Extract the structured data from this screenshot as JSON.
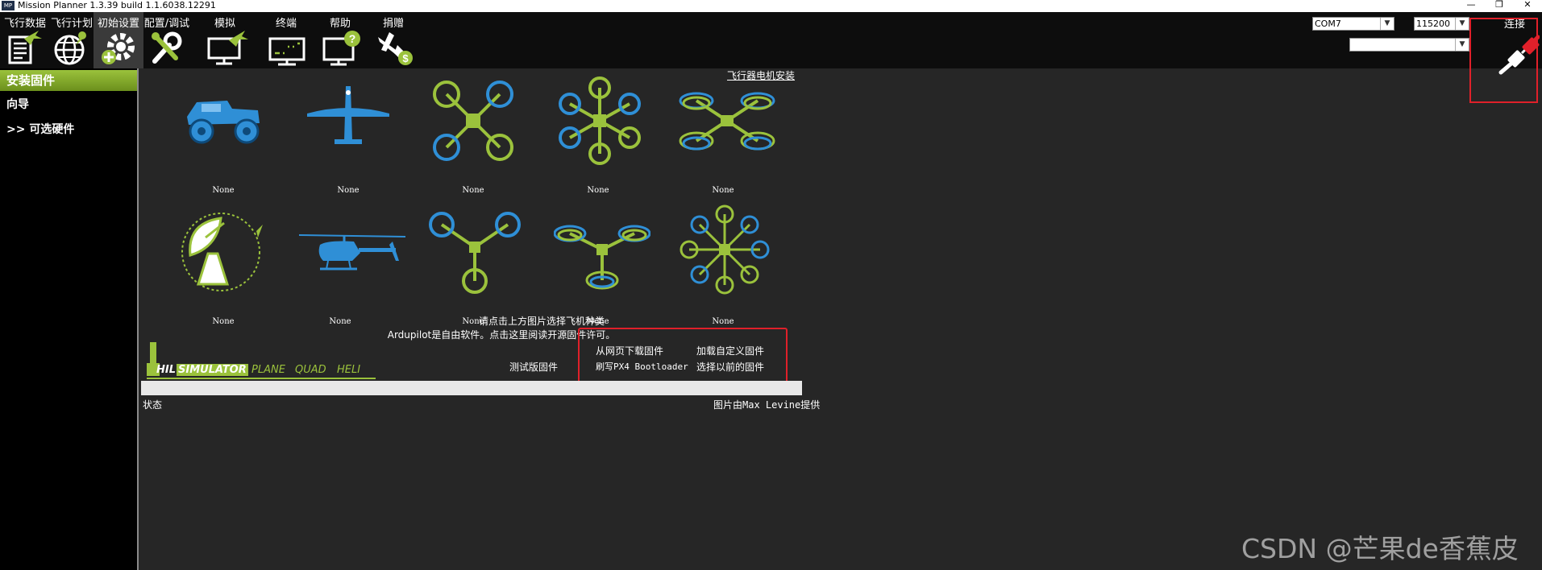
{
  "window": {
    "title": "Mission Planner 1.3.39 build 1.1.6038.12291",
    "logo_text": "MP"
  },
  "toolbar": {
    "menus": [
      {
        "label": "飞行数据",
        "icon": "flight-data-icon"
      },
      {
        "label": "飞行计划",
        "icon": "flight-plan-icon"
      },
      {
        "label": "初始设置",
        "icon": "initial-setup-icon"
      },
      {
        "label": "配置/调试",
        "icon": "config-tuning-icon"
      },
      {
        "label": "模拟",
        "icon": "simulation-icon"
      },
      {
        "label": "终端",
        "icon": "terminal-icon"
      },
      {
        "label": "帮助",
        "icon": "help-icon"
      },
      {
        "label": "捐赠",
        "icon": "donate-icon"
      }
    ],
    "active_menu": "初始设置",
    "port": "COM7",
    "baud": "115200",
    "connect_label": "连接"
  },
  "sidebar": {
    "active": "安装固件",
    "items": [
      "向导",
      ">> 可选硬件"
    ]
  },
  "main": {
    "motor_link": "飞行器电机安装",
    "caption": "None",
    "airframes_row1": [
      "rover-icon",
      "plane-icon",
      "quad-icon",
      "hexa-icon",
      "octa-quad-icon"
    ],
    "airframes_row2": [
      "antenna-tracker-icon",
      "heli-icon",
      "tri-icon",
      "y6-icon",
      "octa-icon"
    ],
    "hint1": "请点击上方图片选择飞机种类",
    "hint2": "Ardupilot是自由软件。点击这里阅读开源固件许可。",
    "beta_firmware": "测试版固件",
    "firmware_links": {
      "download": "从网页下载固件",
      "custom": "加载自定义固件",
      "px4_bootloader": "刷写PX4 Bootloader",
      "previous": "选择以前的固件"
    },
    "hil": {
      "prefix": "HIL",
      "simulator": "SIMULATOR",
      "plane": "PLANE",
      "quad": "QUAD",
      "heli": "HELI"
    },
    "status_label": "状态",
    "credit": "图片由Max Levine提供",
    "progress": 0
  },
  "watermark": "CSDN @芒果de香蕉皮",
  "colors": {
    "accent_green": "#9bc23c",
    "accent_blue": "#2f8fd6",
    "highlight_red": "#e0202a"
  }
}
